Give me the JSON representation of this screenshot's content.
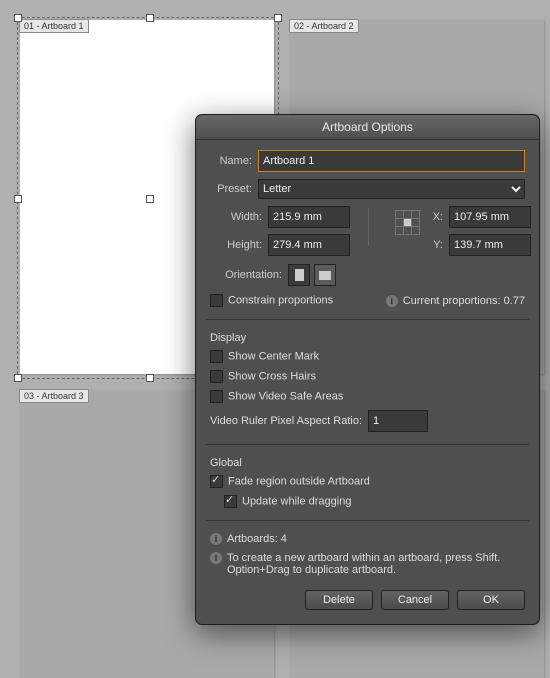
{
  "artboards": {
    "ab1": "01 - Artboard 1",
    "ab2": "02 - Artboard 2",
    "ab3": "03 - Artboard 3"
  },
  "dialog": {
    "title": "Artboard Options",
    "name_lbl": "Name:",
    "name_val": "Artboard 1",
    "preset_lbl": "Preset:",
    "preset_val": "Letter",
    "width_lbl": "Width:",
    "width_val": "215.9 mm",
    "height_lbl": "Height:",
    "height_val": "279.4 mm",
    "x_lbl": "X:",
    "x_val": "107.95 mm",
    "y_lbl": "Y:",
    "y_val": "139.7 mm",
    "orient_lbl": "Orientation:",
    "constrain_lbl": "Constrain proportions",
    "curprop_lbl": "Current proportions: 0.77",
    "display_hdr": "Display",
    "show_center": "Show Center Mark",
    "show_cross": "Show Cross Hairs",
    "show_video": "Show Video Safe Areas",
    "video_ratio_lbl": "Video Ruler Pixel Aspect Ratio:",
    "video_ratio_val": "1",
    "global_hdr": "Global",
    "fade_lbl": "Fade region outside Artboard",
    "update_drag_lbl": "Update while dragging",
    "artboards_count": "Artboards: 4",
    "tip": "To create a new artboard within an artboard, press Shift. Option+Drag to duplicate artboard.",
    "btn_delete": "Delete",
    "btn_cancel": "Cancel",
    "btn_ok": "OK"
  }
}
